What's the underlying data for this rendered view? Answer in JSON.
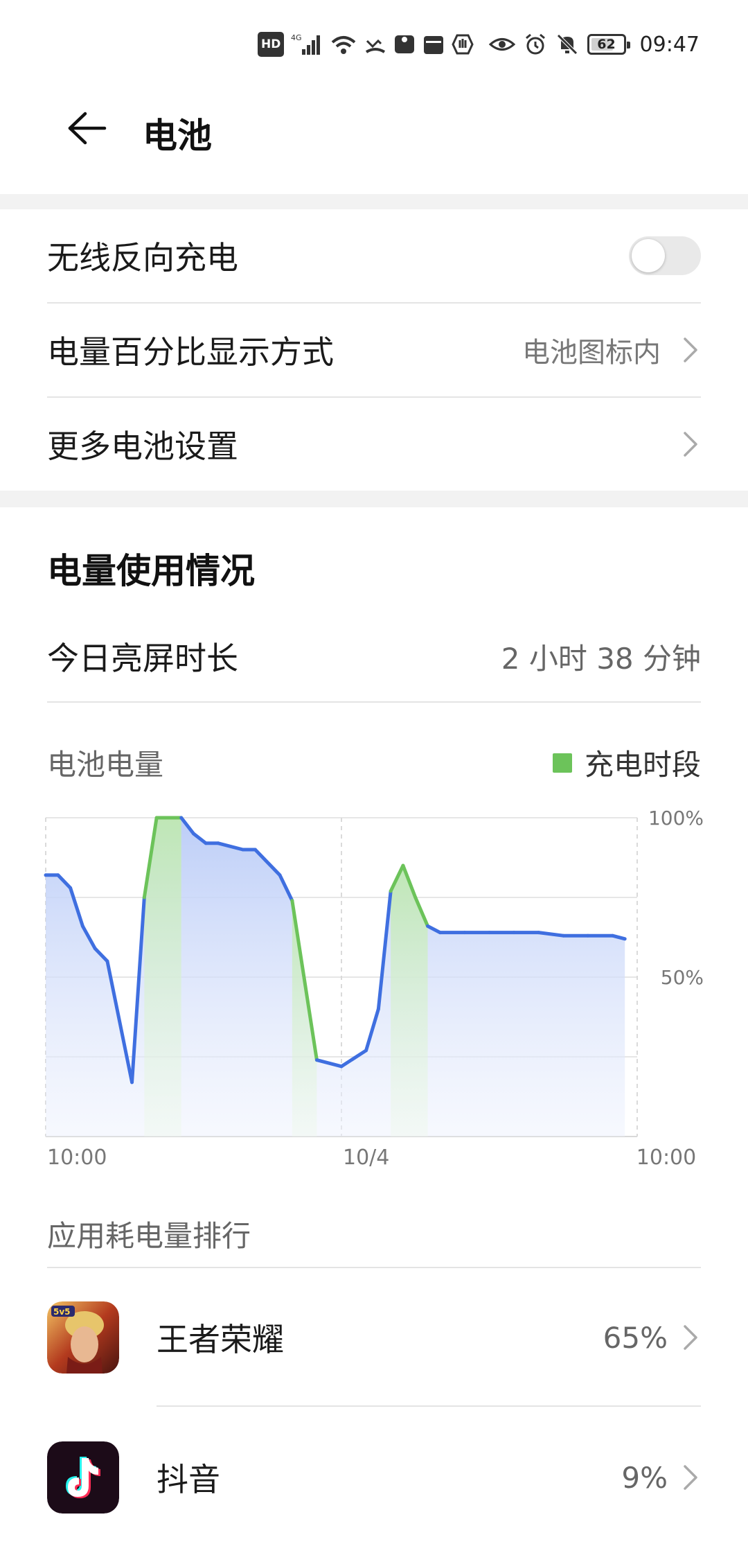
{
  "status_bar": {
    "hd_label": "HD",
    "battery_level": "62",
    "time": "09:47"
  },
  "header": {
    "title": "电池"
  },
  "settings": {
    "wireless_reverse_charging": {
      "label": "无线反向充电",
      "enabled": false
    },
    "battery_percent_display": {
      "label": "电量百分比显示方式",
      "value": "电池图标内"
    },
    "more_battery_settings": {
      "label": "更多电池设置"
    }
  },
  "usage": {
    "section_title": "电量使用情况",
    "screen_time_label": "今日亮屏时长",
    "screen_time_value": "2 小时 38 分钟",
    "chart_title": "电池电量",
    "legend_charging": "充电时段"
  },
  "chart_data": {
    "type": "area",
    "title": "电池电量",
    "x_tick_labels": [
      "10:00",
      "10/4",
      "10:00"
    ],
    "y_tick_labels": [
      "100%",
      "50%"
    ],
    "ylim": [
      0,
      100
    ],
    "x_range_hours": [
      0,
      24
    ],
    "grid": true,
    "legend_placement": "top-right",
    "colors": {
      "discharging": "#3f6fe0",
      "charging": "#6cc35a"
    },
    "x": [
      0,
      0.5,
      1.0,
      1.5,
      2.0,
      2.5,
      3.5,
      4.0,
      4.5,
      5.0,
      5.5,
      6.0,
      6.5,
      7.0,
      8.0,
      8.5,
      9.5,
      10.0,
      11.0,
      12.0,
      13.0,
      13.5,
      14.0,
      14.5,
      15.0,
      15.5,
      16.0,
      17.0,
      18.0,
      19.0,
      20.0,
      21.0,
      22.0,
      23.0,
      23.5
    ],
    "values": [
      82,
      82,
      78,
      66,
      59,
      55,
      17,
      75,
      100,
      100,
      100,
      95,
      92,
      92,
      90,
      90,
      82,
      74,
      24,
      22,
      27,
      40,
      77,
      85,
      75,
      66,
      64,
      64,
      64,
      64,
      64,
      63,
      63,
      63,
      62
    ],
    "charging_periods": [
      [
        4.0,
        5.5
      ],
      [
        10.0,
        11.0
      ],
      [
        14.0,
        15.5
      ]
    ]
  },
  "app_ranking": {
    "title": "应用耗电量排行",
    "apps": [
      {
        "name": "王者荣耀",
        "percent": "65%",
        "icon": "honor-of-kings-icon"
      },
      {
        "name": "抖音",
        "percent": "9%",
        "icon": "douyin-icon"
      }
    ]
  }
}
